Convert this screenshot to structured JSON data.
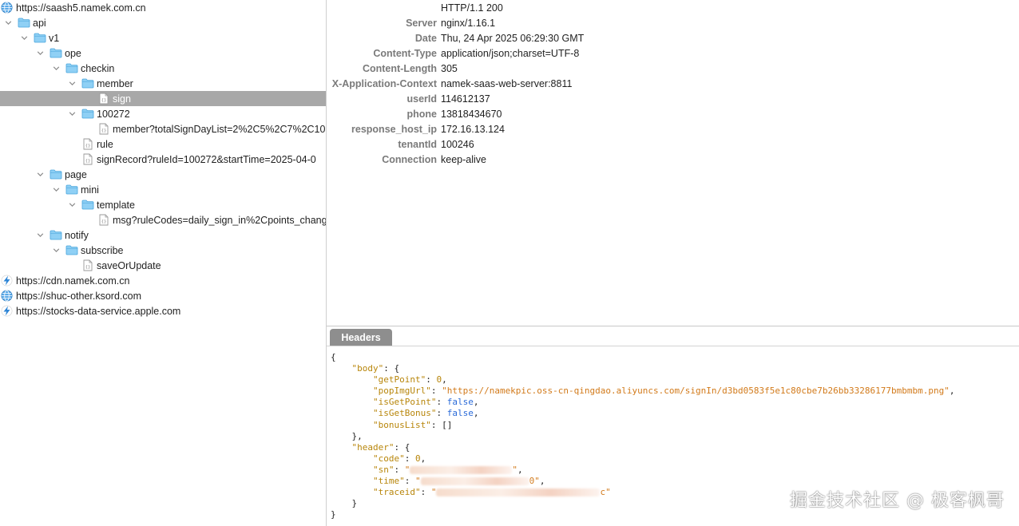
{
  "tree": {
    "rows": [
      {
        "depth": 0,
        "chevron": "none",
        "icon": "globe",
        "label": "https://saash5.namek.com.cn"
      },
      {
        "depth": 0,
        "chevron": "down",
        "icon": "folder",
        "label": "api"
      },
      {
        "depth": 1,
        "chevron": "down",
        "icon": "folder",
        "label": "v1"
      },
      {
        "depth": 2,
        "chevron": "down",
        "icon": "folder",
        "label": "ope"
      },
      {
        "depth": 3,
        "chevron": "down",
        "icon": "folder",
        "label": "checkin"
      },
      {
        "depth": 4,
        "chevron": "down",
        "icon": "folder",
        "label": "member"
      },
      {
        "depth": 5,
        "chevron": "none",
        "icon": "json-file",
        "label": "sign",
        "selected": true
      },
      {
        "depth": 4,
        "chevron": "down",
        "icon": "folder",
        "label": "100272"
      },
      {
        "depth": 5,
        "chevron": "none",
        "icon": "json-file",
        "label": "member?totalSignDayList=2%2C5%2C7%2C10"
      },
      {
        "depth": 4,
        "chevron": "none",
        "icon": "json-file",
        "label": "rule"
      },
      {
        "depth": 4,
        "chevron": "none",
        "icon": "json-file",
        "label": "signRecord?ruleId=100272&startTime=2025-04-0"
      },
      {
        "depth": 2,
        "chevron": "down",
        "icon": "folder",
        "label": "page"
      },
      {
        "depth": 3,
        "chevron": "down",
        "icon": "folder",
        "label": "mini"
      },
      {
        "depth": 4,
        "chevron": "down",
        "icon": "folder",
        "label": "template"
      },
      {
        "depth": 5,
        "chevron": "none",
        "icon": "json-file",
        "label": "msg?ruleCodes=daily_sign_in%2Cpoints_chang"
      },
      {
        "depth": 2,
        "chevron": "down",
        "icon": "folder",
        "label": "notify"
      },
      {
        "depth": 3,
        "chevron": "down",
        "icon": "folder",
        "label": "subscribe"
      },
      {
        "depth": 4,
        "chevron": "none",
        "icon": "json-file",
        "label": "saveOrUpdate"
      },
      {
        "depth": 0,
        "chevron": "none",
        "icon": "bolt",
        "label": "https://cdn.namek.com.cn"
      },
      {
        "depth": 0,
        "chevron": "none",
        "icon": "globe",
        "label": "https://shuc-other.ksord.com"
      },
      {
        "depth": 0,
        "chevron": "none",
        "icon": "bolt",
        "label": "https://stocks-data-service.apple.com"
      }
    ]
  },
  "response_headers": [
    {
      "key": "",
      "value": "HTTP/1.1 200"
    },
    {
      "key": "Server",
      "value": "nginx/1.16.1"
    },
    {
      "key": "Date",
      "value": "Thu, 24 Apr 2025 06:29:30 GMT"
    },
    {
      "key": "Content-Type",
      "value": "application/json;charset=UTF-8"
    },
    {
      "key": "Content-Length",
      "value": "305"
    },
    {
      "key": "X-Application-Context",
      "value": "namek-saas-web-server:8811"
    },
    {
      "key": "userId",
      "value": "114612137"
    },
    {
      "key": "phone",
      "value": "13818434670"
    },
    {
      "key": "response_host_ip",
      "value": "172.16.13.124"
    },
    {
      "key": "tenantId",
      "value": "100246"
    },
    {
      "key": "Connection",
      "value": "keep-alive"
    }
  ],
  "bottom_panel": {
    "tab_label": "Headers",
    "json": {
      "open_brace": "{",
      "body_key": "\"body\"",
      "body_open": ": {",
      "getPoint_key": "\"getPoint\"",
      "getPoint_val": "0",
      "popImgUrl_key": "\"popImgUrl\"",
      "popImgUrl_val": "\"https://namekpic.oss-cn-qingdao.aliyuncs.com/signIn/d3bd0583f5e1c80cbe7b26bb33286177bmbmbm.png\"",
      "isGetPoint_key": "\"isGetPoint\"",
      "isGetPoint_val": "false",
      "isGetBonus_key": "\"isGetBonus\"",
      "isGetBonus_val": "false",
      "bonusList_key": "\"bonusList\"",
      "bonusList_val": "[]",
      "body_close": "},",
      "header_key": "\"header\"",
      "header_open": ": {",
      "code_key": "\"code\"",
      "code_val": "0",
      "sn_key": "\"sn\"",
      "sn_val_start": "\"",
      "sn_val_end": "\"",
      "time_key": "\"time\"",
      "time_val_start": "\"",
      "time_val_end": "0\"",
      "traceid_key": "\"traceid\"",
      "traceid_val_start": "\"",
      "traceid_val_end": "c\"",
      "header_close": "}",
      "close_brace": "}"
    }
  },
  "watermark": "掘金技术社区 @ 极客枫哥",
  "colors": {
    "selected_row": "#a8a8a8",
    "folder": "#7cc6ef",
    "json_key": "#b8860b",
    "json_string": "#d27a1a",
    "json_boolean": "#2a6ad8",
    "header_key": "#7a7a7a",
    "tab": "#8e8e8e"
  }
}
